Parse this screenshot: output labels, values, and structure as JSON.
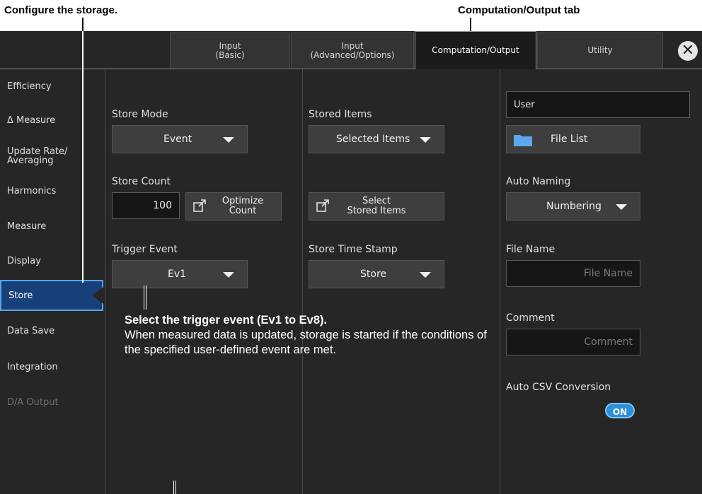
{
  "annotations": {
    "configure_storage": "Configure the storage.",
    "tab_callout": "Computation/Output tab",
    "trigger_title": "Select the trigger event (Ev1 to Ev8).",
    "trigger_desc": "When measured data is updated, storage is started if the conditions of the specified user-defined event are met."
  },
  "tabs": [
    {
      "label": "Input\n(Basic)",
      "active": false
    },
    {
      "label": "Input\n(Advanced/Options)",
      "active": false
    },
    {
      "label": "Computation/Output",
      "active": true
    },
    {
      "label": "Utility",
      "active": false
    }
  ],
  "close_icon": "✕",
  "sidebar": {
    "items": [
      {
        "label": "Efficiency"
      },
      {
        "label": "Δ Measure"
      },
      {
        "label": "Update Rate/\nAveraging"
      },
      {
        "label": "Harmonics"
      },
      {
        "label": "Measure"
      },
      {
        "label": "Display"
      },
      {
        "label": "Store",
        "active": true
      },
      {
        "label": "Data Save"
      },
      {
        "label": "Integration"
      },
      {
        "label": "D/A Output",
        "disabled": true
      }
    ]
  },
  "col1": {
    "store_mode_label": "Store Mode",
    "store_mode_value": "Event",
    "store_count_label": "Store Count",
    "store_count_value": "100",
    "optimize_label": "Optimize\nCount",
    "trigger_event_label": "Trigger Event",
    "trigger_event_value": "Ev1"
  },
  "col2": {
    "stored_items_label": "Stored Items",
    "stored_items_value": "Selected Items",
    "select_items_label": "Select\nStored Items",
    "timestamp_label": "Store Time Stamp",
    "timestamp_value": "Store"
  },
  "col3": {
    "user_path": "User",
    "file_list_label": "File List",
    "auto_naming_label": "Auto Naming",
    "auto_naming_value": "Numbering",
    "file_name_label": "File Name",
    "file_name_placeholder": "File Name",
    "comment_label": "Comment",
    "comment_placeholder": "Comment",
    "auto_csv_label": "Auto CSV Conversion",
    "auto_csv_value": "ON"
  }
}
